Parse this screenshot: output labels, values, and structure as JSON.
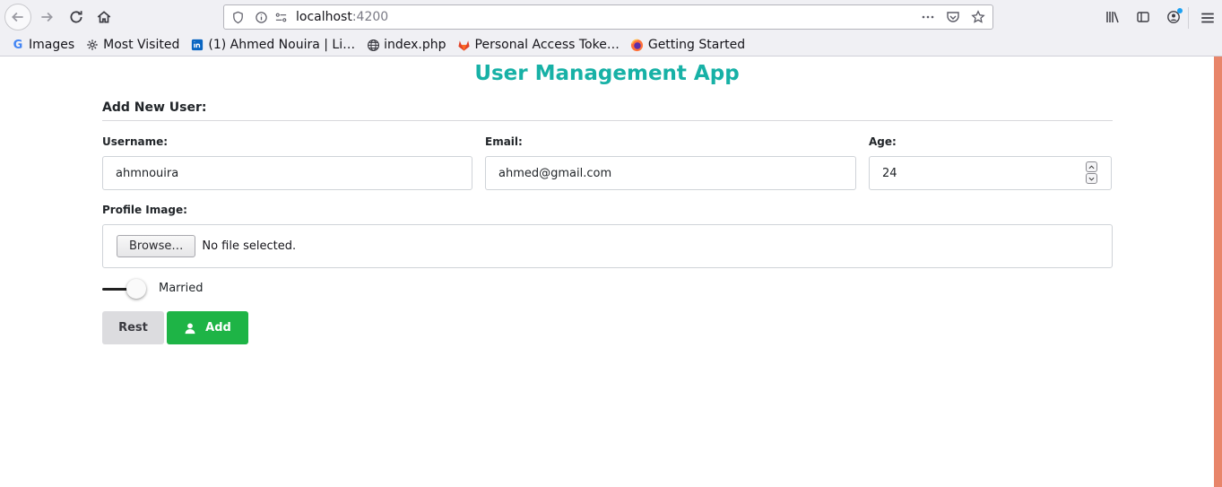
{
  "browser": {
    "url_host": "localhost",
    "url_port": ":4200",
    "bookmarks": [
      {
        "label": "Images",
        "icon": "google-icon"
      },
      {
        "label": "Most Visited",
        "icon": "gear-icon"
      },
      {
        "label": "(1) Ahmed Nouira | Li…",
        "icon": "linkedin-icon"
      },
      {
        "label": "index.php",
        "icon": "globe-icon"
      },
      {
        "label": "Personal Access Toke…",
        "icon": "gitlab-icon"
      },
      {
        "label": "Getting Started",
        "icon": "firefox-icon"
      }
    ]
  },
  "page": {
    "title": "User Management App",
    "section_title": "Add New User:",
    "form": {
      "username_label": "Username:",
      "username_value": "ahmnouira",
      "email_label": "Email:",
      "email_value": "ahmed@gmail.com",
      "age_label": "Age:",
      "age_value": "24",
      "profile_image_label": "Profile Image:",
      "browse_label": "Browse…",
      "file_status": "No file selected.",
      "married_label": "Married",
      "married_checked": false
    },
    "buttons": {
      "reset_label": "Rest",
      "add_label": "Add"
    },
    "colors": {
      "title": "#17b1a6",
      "add_button": "#1eb446",
      "reset_button": "#dcdcdf",
      "scroll_edge": "#e8856a"
    }
  }
}
